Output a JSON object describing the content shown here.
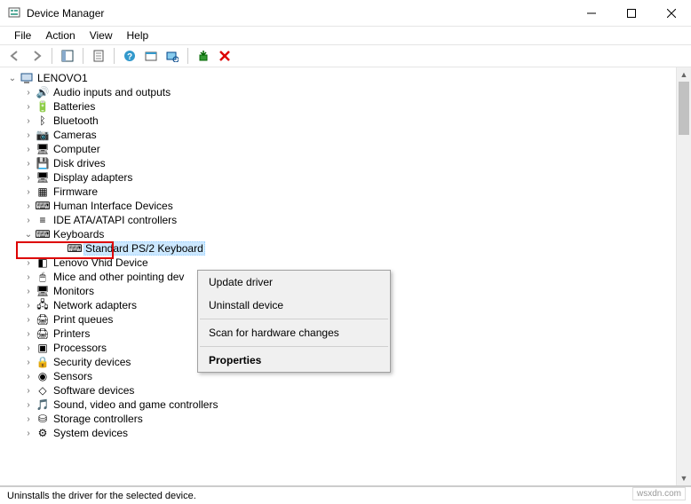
{
  "window": {
    "title": "Device Manager"
  },
  "menu": {
    "file": "File",
    "action": "Action",
    "view": "View",
    "help": "Help"
  },
  "tree": {
    "root": "LENOVO1",
    "items": [
      {
        "label": "Audio inputs and outputs",
        "icon": "audio"
      },
      {
        "label": "Batteries",
        "icon": "battery"
      },
      {
        "label": "Bluetooth",
        "icon": "bluetooth"
      },
      {
        "label": "Cameras",
        "icon": "camera"
      },
      {
        "label": "Computer",
        "icon": "computer"
      },
      {
        "label": "Disk drives",
        "icon": "disk"
      },
      {
        "label": "Display adapters",
        "icon": "display"
      },
      {
        "label": "Firmware",
        "icon": "firmware"
      },
      {
        "label": "Human Interface Devices",
        "icon": "hid"
      },
      {
        "label": "IDE ATA/ATAPI controllers",
        "icon": "ide"
      },
      {
        "label": "Keyboards",
        "icon": "keyboard",
        "expanded": true,
        "highlighted": true,
        "children": [
          {
            "label": "Standard PS/2 Keyboard",
            "icon": "keyboard",
            "selected": true
          }
        ]
      },
      {
        "label": "Lenovo Vhid Device",
        "icon": "generic"
      },
      {
        "label": "Mice and other pointing dev",
        "icon": "mouse"
      },
      {
        "label": "Monitors",
        "icon": "monitor"
      },
      {
        "label": "Network adapters",
        "icon": "network"
      },
      {
        "label": "Print queues",
        "icon": "printqueue"
      },
      {
        "label": "Printers",
        "icon": "printer"
      },
      {
        "label": "Processors",
        "icon": "cpu"
      },
      {
        "label": "Security devices",
        "icon": "security"
      },
      {
        "label": "Sensors",
        "icon": "sensor"
      },
      {
        "label": "Software devices",
        "icon": "software"
      },
      {
        "label": "Sound, video and game controllers",
        "icon": "sound"
      },
      {
        "label": "Storage controllers",
        "icon": "storage"
      },
      {
        "label": "System devices",
        "icon": "system"
      }
    ]
  },
  "context_menu": {
    "update": "Update driver",
    "uninstall": "Uninstall device",
    "scan": "Scan for hardware changes",
    "properties": "Properties"
  },
  "statusbar": {
    "text": "Uninstalls the driver for the selected device."
  },
  "watermark": "wsxdn.com",
  "icons": {
    "audio": "🔊",
    "battery": "🔋",
    "bluetooth": "ᛒ",
    "camera": "📷",
    "computer": "🖥",
    "disk": "💾",
    "display": "🖥",
    "firmware": "▦",
    "hid": "⌨",
    "ide": "≡",
    "keyboard": "⌨",
    "generic": "◧",
    "mouse": "🖱",
    "monitor": "🖥",
    "network": "🖧",
    "printqueue": "🖨",
    "printer": "🖨",
    "cpu": "▣",
    "security": "🔒",
    "sensor": "◉",
    "software": "◇",
    "sound": "🎵",
    "storage": "⛁",
    "system": "⚙"
  }
}
